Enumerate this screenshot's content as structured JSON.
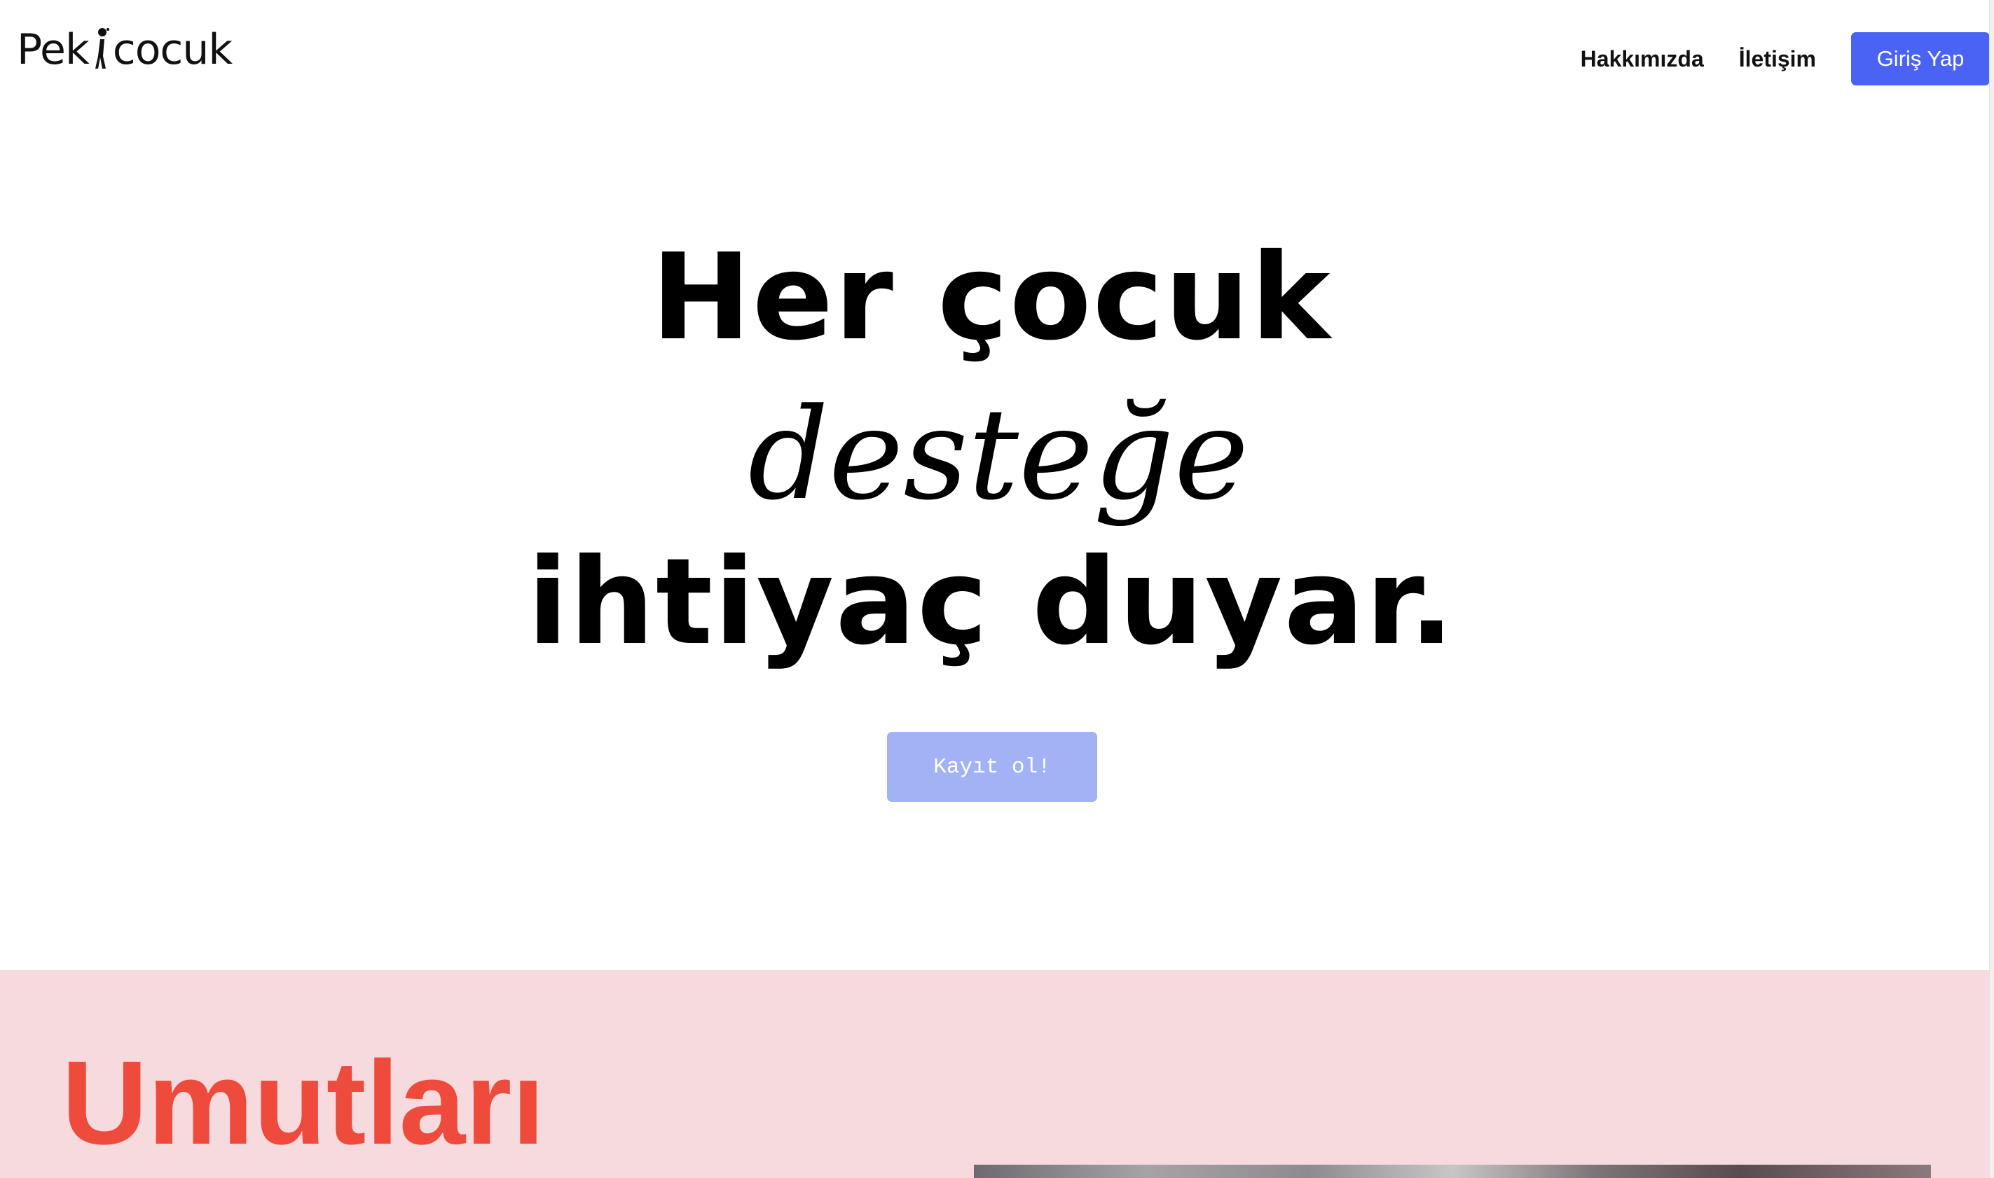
{
  "header": {
    "logo_text_left": "Pek",
    "logo_text_right": "cocuk",
    "nav": {
      "about": "Hakkımızda",
      "contact": "İletişim",
      "login": "Giriş Yap"
    }
  },
  "hero": {
    "line1": "Her çocuk",
    "line2": "desteğe",
    "line3": "ihtiyaç duyar.",
    "signup": "Kayıt ol!"
  },
  "section": {
    "title": "Umutları"
  },
  "colors": {
    "accent": "#4a63f5",
    "signup_button": "#a3b2f5",
    "section_bg": "#f7dadd",
    "section_title": "#ee4b3c"
  }
}
